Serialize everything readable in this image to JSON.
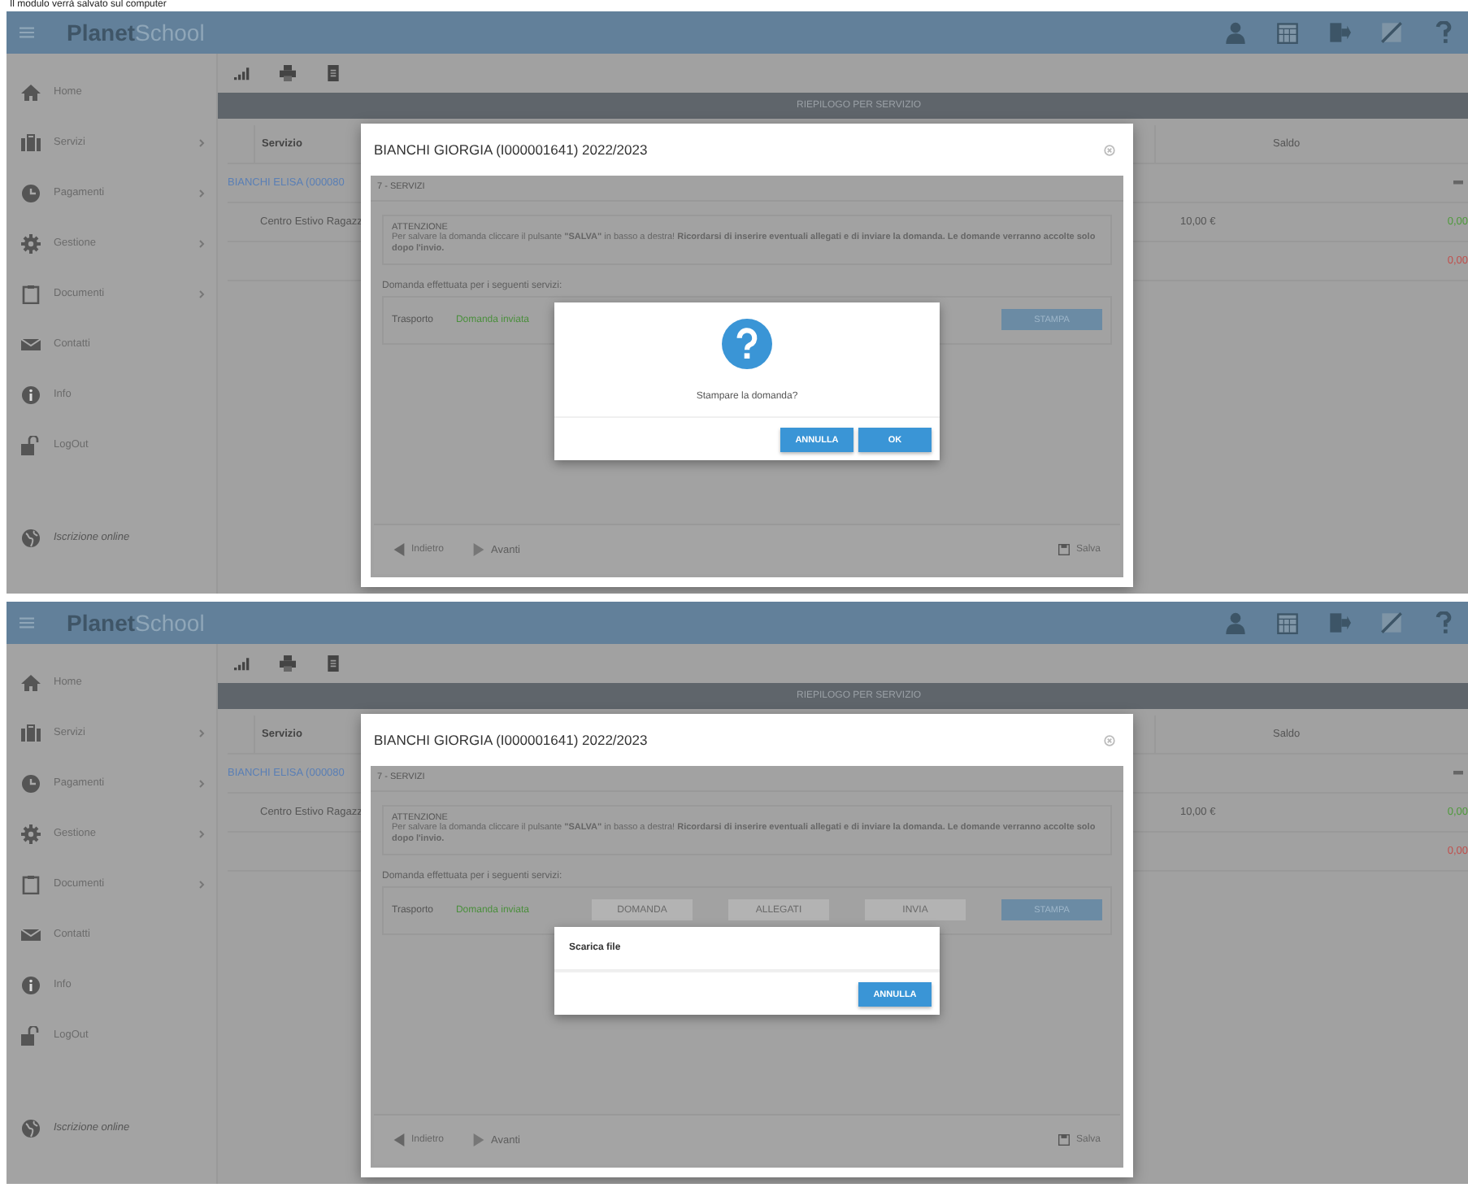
{
  "caption": "Il modulo verrà salvato sul computer",
  "screens": [
    {
      "app": {
        "logo_bold": "Planet",
        "logo_rest": "School"
      },
      "sidebar": {
        "items": [
          {
            "kind": "home",
            "label": "Home",
            "submenu": false
          },
          {
            "kind": "briefcase",
            "label": "Servizi",
            "submenu": true
          },
          {
            "kind": "clock",
            "label": "Pagamenti",
            "submenu": true
          },
          {
            "kind": "gear",
            "label": "Gestione",
            "submenu": true
          },
          {
            "kind": "clipboard",
            "label": "Documenti",
            "submenu": true
          },
          {
            "kind": "mail",
            "label": "Contatti",
            "submenu": false
          },
          {
            "kind": "info",
            "label": "Info",
            "submenu": false
          },
          {
            "kind": "lock",
            "label": "LogOut",
            "submenu": false
          }
        ],
        "footer_link": "Iscrizione online"
      },
      "section_title": "RIEPILOGO PER SERVIZIO",
      "table": {
        "columns": [
          "Servizio",
          "Saldo"
        ],
        "rows": [
          {
            "kind": "group",
            "label": "BIANCHI ELISA (000080"
          },
          {
            "kind": "item",
            "label": "Centro Estivo Ragazz",
            "amount": "10,00 €",
            "balance": "0,00",
            "color": "#4f9a3c"
          },
          {
            "kind": "total",
            "balance": "0,00",
            "color": "#c0504d"
          }
        ]
      },
      "modal": {
        "title": "BIANCHI GIORGIA (I000001641) 2022/2023",
        "step": "7 - SERVIZI",
        "alert_title": "ATTENZIONE",
        "alert_text": "Per salvare la domanda cliccare il pulsante **\"SALVA\"** in basso a destra! **Ricordarsi di inserire eventuali allegati e di inviare la domanda. Le domande verranno accolte solo dopo l'invio.**",
        "list_label": "Domanda effettuata per i seguenti servizi:",
        "service": "Trasporto",
        "status": "Domanda inviata",
        "actions": [
          {
            "label": "STAMPA",
            "disabled": false
          }
        ],
        "back": "Indietro",
        "next": "Avanti",
        "save": "Salva"
      },
      "dialog": {
        "kind": "confirm",
        "message": "Stampare la domanda?",
        "buttons": [
          "ANNULLA",
          "OK"
        ]
      }
    },
    {
      "app": {
        "logo_bold": "Planet",
        "logo_rest": "School"
      },
      "sidebar": {
        "items": [
          {
            "kind": "home",
            "label": "Home",
            "submenu": false
          },
          {
            "kind": "briefcase",
            "label": "Servizi",
            "submenu": true
          },
          {
            "kind": "clock",
            "label": "Pagamenti",
            "submenu": true
          },
          {
            "kind": "gear",
            "label": "Gestione",
            "submenu": true
          },
          {
            "kind": "clipboard",
            "label": "Documenti",
            "submenu": true
          },
          {
            "kind": "mail",
            "label": "Contatti",
            "submenu": false
          },
          {
            "kind": "info",
            "label": "Info",
            "submenu": false
          },
          {
            "kind": "lock",
            "label": "LogOut",
            "submenu": false
          }
        ],
        "footer_link": "Iscrizione online"
      },
      "section_title": "RIEPILOGO PER SERVIZIO",
      "table": {
        "columns": [
          "Servizio",
          "Saldo"
        ],
        "rows": [
          {
            "kind": "group",
            "label": "BIANCHI ELISA (000080"
          },
          {
            "kind": "item",
            "label": "Centro Estivo Ragazz",
            "amount": "10,00 €",
            "balance": "0,00",
            "color": "#4f9a3c"
          },
          {
            "kind": "total",
            "balance": "0,00",
            "color": "#c0504d"
          }
        ]
      },
      "modal": {
        "title": "BIANCHI GIORGIA (I000001641) 2022/2023",
        "step": "7 - SERVIZI",
        "alert_title": "ATTENZIONE",
        "alert_text": "Per salvare la domanda cliccare il pulsante **\"SALVA\"** in basso a destra! **Ricordarsi di inserire eventuali allegati e di inviare la domanda. Le domande verranno accolte solo dopo l'invio.**",
        "list_label": "Domanda effettuata per i seguenti servizi:",
        "service": "Trasporto",
        "status": "Domanda inviata",
        "actions": [
          {
            "label": "DOMANDA",
            "disabled": true
          },
          {
            "label": "ALLEGATI",
            "disabled": true
          },
          {
            "label": "INVIA",
            "disabled": true
          },
          {
            "label": "STAMPA",
            "disabled": false
          }
        ],
        "back": "Indietro",
        "next": "Avanti",
        "save": "Salva"
      },
      "dialog": {
        "kind": "download",
        "title": "Scarica file",
        "buttons": [
          "ANNULLA"
        ]
      }
    }
  ]
}
